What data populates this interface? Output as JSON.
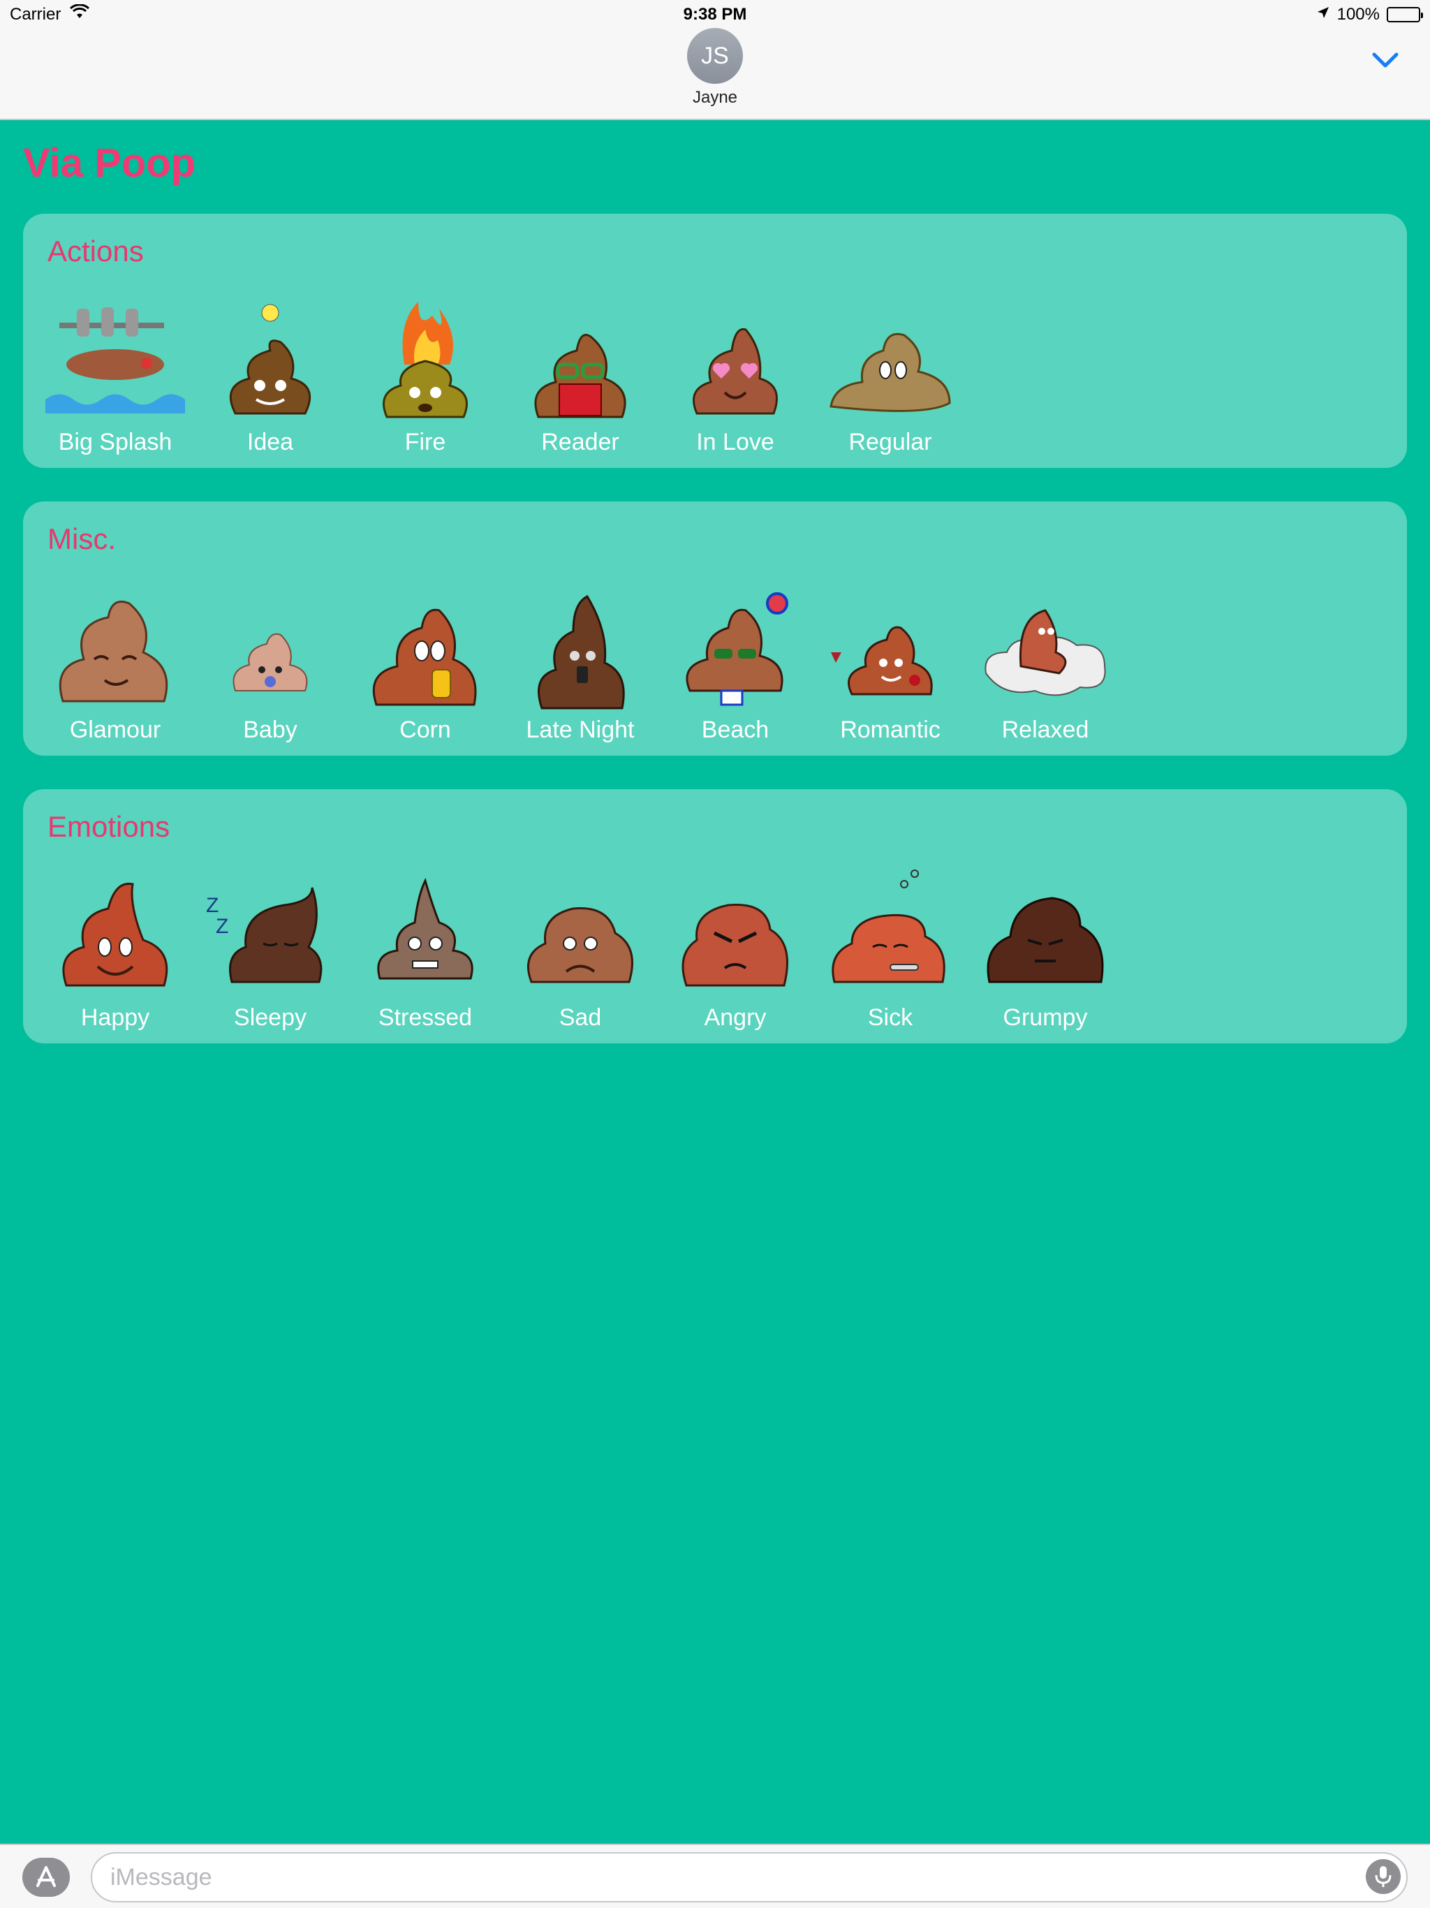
{
  "status_bar": {
    "carrier": "Carrier",
    "time": "9:38 PM",
    "battery": "100%",
    "battery_level": 1.0
  },
  "header": {
    "avatar_initials": "JS",
    "contact_name": "Jayne",
    "collapse_icon": "chevron-down-icon",
    "accent": "#1a7cf5"
  },
  "app": {
    "title": "Via Poop",
    "title_color": "#f03a74",
    "background": "#00bd9b"
  },
  "sections": [
    {
      "title": "Actions",
      "stickers": [
        {
          "label": "Big Splash",
          "icon": "big-splash-sticker"
        },
        {
          "label": "Idea",
          "icon": "idea-sticker"
        },
        {
          "label": "Fire",
          "icon": "fire-sticker"
        },
        {
          "label": "Reader",
          "icon": "reader-sticker"
        },
        {
          "label": "In Love",
          "icon": "in-love-sticker"
        },
        {
          "label": "Regular",
          "icon": "regular-sticker"
        }
      ]
    },
    {
      "title": "Misc.",
      "stickers": [
        {
          "label": "Glamour",
          "icon": "glamour-sticker"
        },
        {
          "label": "Baby",
          "icon": "baby-sticker"
        },
        {
          "label": "Corn",
          "icon": "corn-sticker"
        },
        {
          "label": "Late Night",
          "icon": "late-night-sticker"
        },
        {
          "label": "Beach",
          "icon": "beach-sticker"
        },
        {
          "label": "Romantic",
          "icon": "romantic-sticker"
        },
        {
          "label": "Relaxed",
          "icon": "relaxed-sticker"
        }
      ]
    },
    {
      "title": "Emotions",
      "stickers": [
        {
          "label": "Happy",
          "icon": "happy-sticker"
        },
        {
          "label": "Sleepy",
          "icon": "sleepy-sticker"
        },
        {
          "label": "Stressed",
          "icon": "stressed-sticker"
        },
        {
          "label": "Sad",
          "icon": "sad-sticker"
        },
        {
          "label": "Angry",
          "icon": "angry-sticker"
        },
        {
          "label": "Sick",
          "icon": "sick-sticker"
        },
        {
          "label": "Grumpy",
          "icon": "grumpy-sticker"
        }
      ]
    }
  ],
  "input_bar": {
    "placeholder": "iMessage",
    "app_store_icon": "app-store-icon",
    "mic_icon": "microphone-icon"
  }
}
